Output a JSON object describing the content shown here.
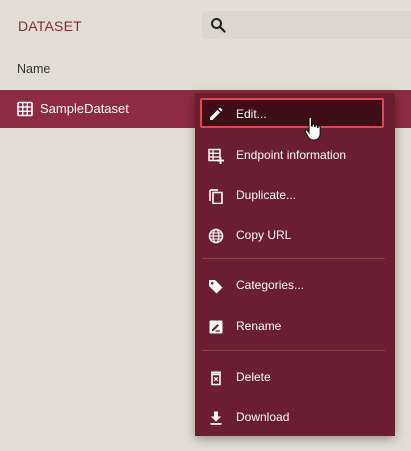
{
  "header": {
    "title": "DATASET",
    "search_icon": "search-icon"
  },
  "table": {
    "column_name": "Name",
    "rows": [
      {
        "label": "SampleDataset",
        "icon": "table-icon"
      }
    ]
  },
  "context_menu": {
    "items": [
      {
        "label": "Edit...",
        "icon": "pencil-icon"
      },
      {
        "label": "Endpoint information",
        "icon": "endpoint-table-icon"
      },
      {
        "label": "Duplicate...",
        "icon": "duplicate-icon"
      },
      {
        "label": "Copy URL",
        "icon": "globe-icon"
      },
      {
        "label": "Categories...",
        "icon": "tag-icon"
      },
      {
        "label": "Rename",
        "icon": "rename-icon"
      },
      {
        "label": "Delete",
        "icon": "trash-icon"
      },
      {
        "label": "Download",
        "icon": "download-icon"
      }
    ]
  },
  "colors": {
    "accent": "#8e2c3f",
    "menu_bg": "#6b1e2f",
    "highlight_border": "#e0484f",
    "background": "#e3ded2"
  }
}
